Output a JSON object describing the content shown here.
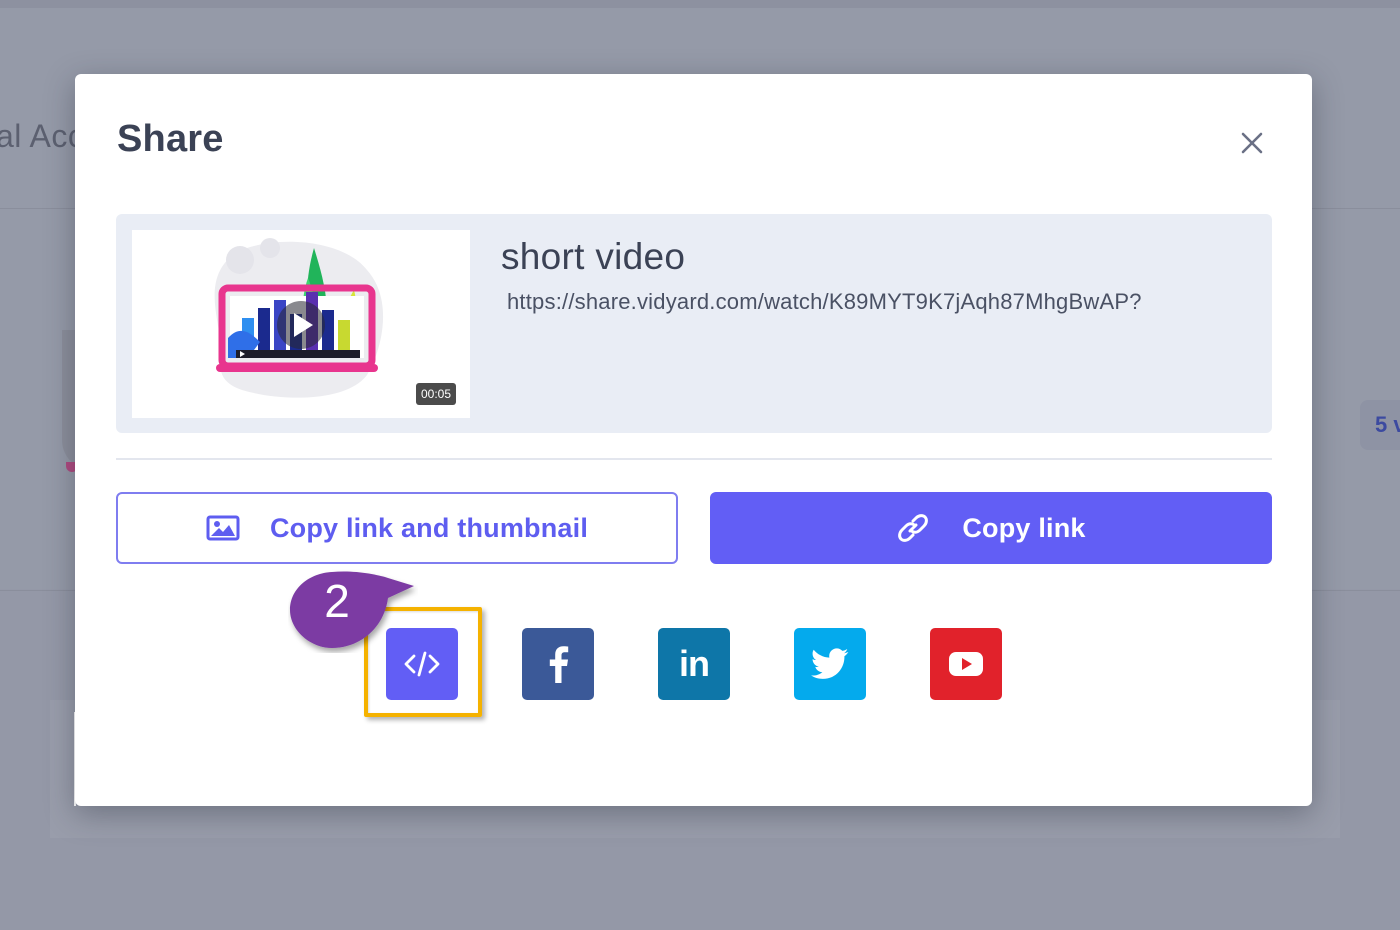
{
  "background": {
    "header_text": "al Acc",
    "badge_text": "5 v"
  },
  "modal": {
    "title": "Share",
    "close_icon": "close-icon"
  },
  "video": {
    "title": "short video",
    "url": "https://share.vidyard.com/watch/K89MYT9K7jAqh87MhgBwAP?",
    "duration": "00:05"
  },
  "actions": {
    "copy_link_thumbnail_label": "Copy link and thumbnail",
    "copy_link_thumbnail_icon": "image-icon",
    "copy_link_label": "Copy link",
    "copy_link_icon": "link-icon"
  },
  "share_targets": [
    {
      "name": "Embed",
      "icon": "code-icon",
      "color": "#625ef5"
    },
    {
      "name": "Facebook",
      "icon": "facebook-icon",
      "color": "#3b5998"
    },
    {
      "name": "LinkedIn",
      "icon": "linkedin-icon",
      "color": "#0e76a8",
      "glyph": "in"
    },
    {
      "name": "Twitter",
      "icon": "twitter-icon",
      "color": "#04aaed"
    },
    {
      "name": "YouTube",
      "icon": "youtube-icon",
      "color": "#e1222b"
    }
  ],
  "annotation": {
    "step_number": "2",
    "callout_color": "#7b3aa3",
    "highlight_color": "#f5b200"
  },
  "colors": {
    "accent": "#625ef5",
    "text_primary": "#3b4255",
    "card_bg": "#e9edf5",
    "overlay_bg": "#9498a7"
  }
}
